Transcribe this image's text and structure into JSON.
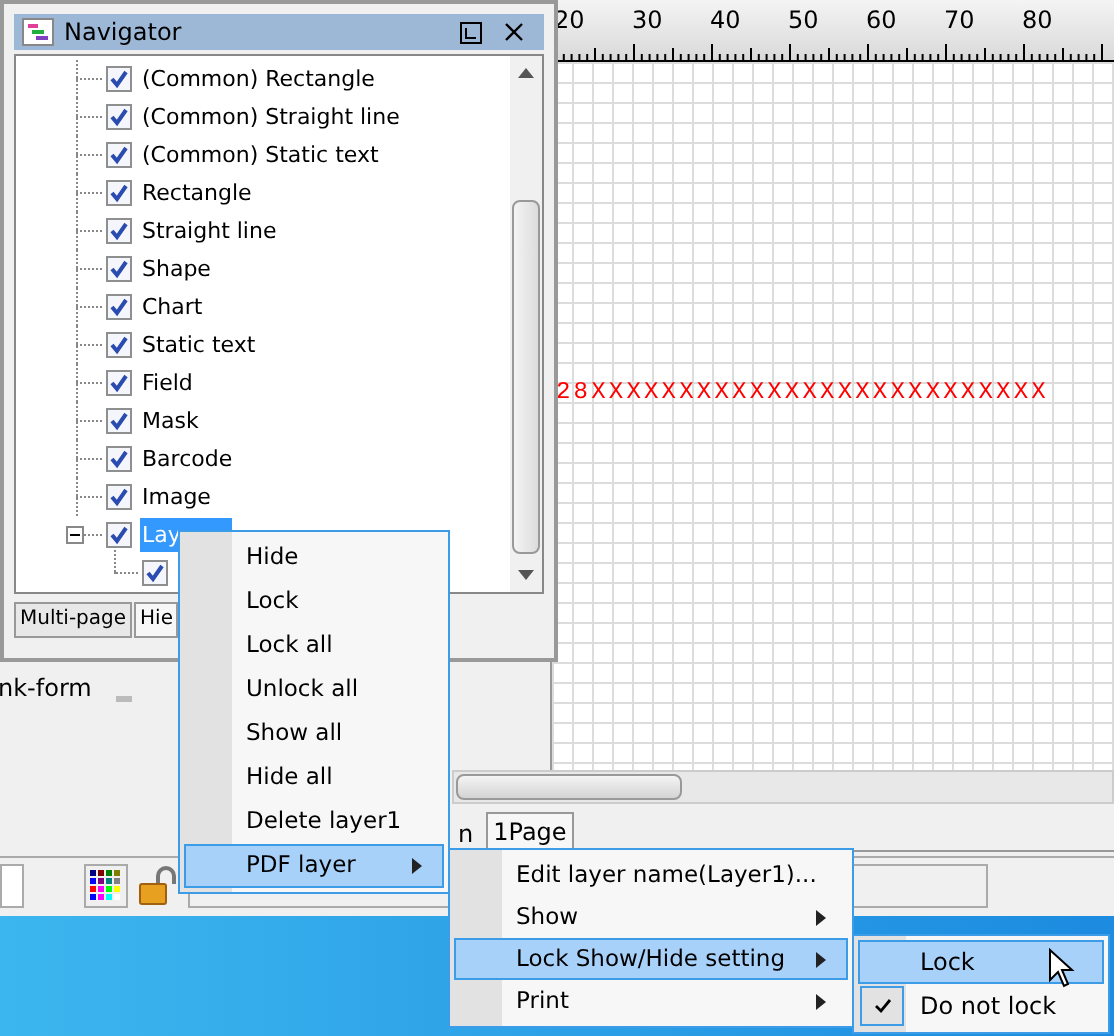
{
  "navigator": {
    "title": "Navigator",
    "items": [
      {
        "label": "(Common) Rectangle",
        "checked": true,
        "selected": false
      },
      {
        "label": "(Common) Straight line",
        "checked": true,
        "selected": false
      },
      {
        "label": "(Common) Static text",
        "checked": true,
        "selected": false
      },
      {
        "label": "Rectangle",
        "checked": true,
        "selected": false
      },
      {
        "label": "Straight line",
        "checked": true,
        "selected": false
      },
      {
        "label": "Shape",
        "checked": true,
        "selected": false
      },
      {
        "label": "Chart",
        "checked": true,
        "selected": false
      },
      {
        "label": "Static text",
        "checked": true,
        "selected": false
      },
      {
        "label": "Field",
        "checked": true,
        "selected": false
      },
      {
        "label": "Mask",
        "checked": true,
        "selected": false
      },
      {
        "label": "Barcode",
        "checked": true,
        "selected": false
      },
      {
        "label": "Image",
        "checked": true,
        "selected": false
      },
      {
        "label": "Lay",
        "checked": true,
        "selected": true,
        "expanded": true,
        "children": [
          {
            "checked": true
          }
        ]
      }
    ],
    "tabs": [
      {
        "label": "Multi-page",
        "selected": true
      },
      {
        "label": "Hie",
        "selected": false
      }
    ]
  },
  "ruler": {
    "labels": [
      "20",
      "30",
      "40",
      "50",
      "60",
      "70",
      "80"
    ]
  },
  "canvas_text": "28XXXXXXXXXXXXXXXXXXXXXXXXXX",
  "form_label": "nk-form",
  "page_tabs": [
    {
      "label": "n",
      "selected": false
    },
    {
      "label": "1Page",
      "selected": true
    }
  ],
  "context_menu": [
    {
      "label": "Hide",
      "submenu": false,
      "selected": false
    },
    {
      "label": "Lock",
      "submenu": false,
      "selected": false
    },
    {
      "label": "Lock all",
      "submenu": false,
      "selected": false
    },
    {
      "label": "Unlock all",
      "submenu": false,
      "selected": false
    },
    {
      "label": "Show all",
      "submenu": false,
      "selected": false
    },
    {
      "label": "Hide all",
      "submenu": false,
      "selected": false
    },
    {
      "label": "Delete layer1",
      "submenu": false,
      "selected": false
    },
    {
      "label": "PDF layer",
      "submenu": true,
      "selected": true
    }
  ],
  "pdf_layer_menu": [
    {
      "label": "Edit layer name(Layer1)...",
      "submenu": false,
      "selected": false
    },
    {
      "label": "Show",
      "submenu": true,
      "selected": false
    },
    {
      "label": "Lock Show/Hide setting",
      "submenu": true,
      "selected": true
    },
    {
      "label": "Print",
      "submenu": true,
      "selected": false
    }
  ],
  "lock_menu": [
    {
      "label": "Lock",
      "checked": false,
      "selected": true
    },
    {
      "label": "Do not lock",
      "checked": true,
      "selected": false
    }
  ]
}
